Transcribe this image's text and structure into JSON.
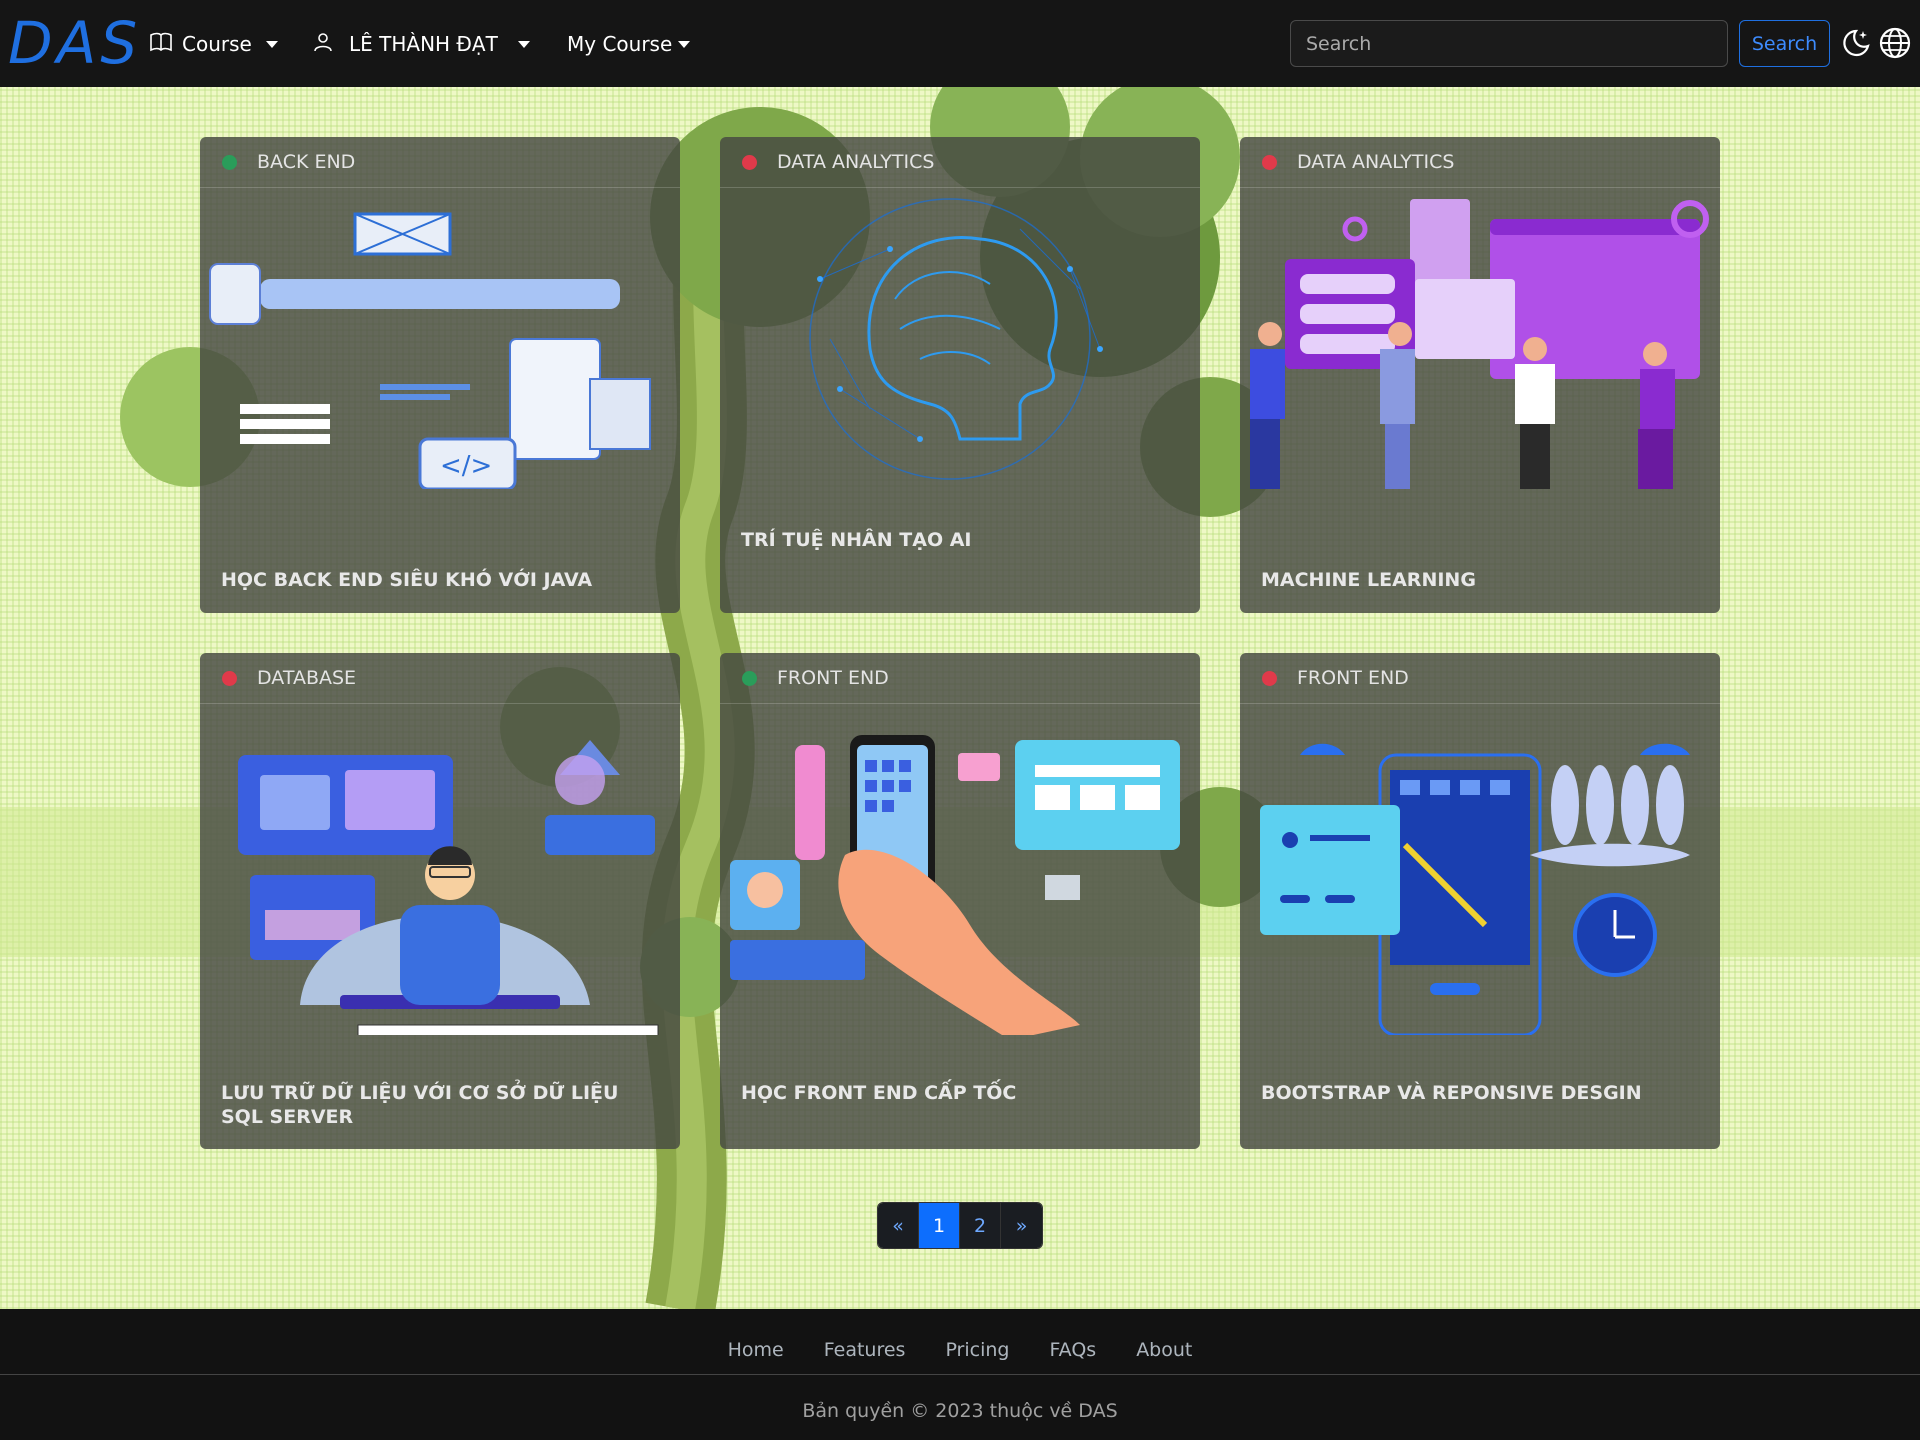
{
  "navbar": {
    "brand": "DAS",
    "course_label": "Course",
    "user_label": "LÊ THÀNH ĐẠT",
    "my_course_label": "My Course",
    "search_placeholder": "Search",
    "search_button": "Search"
  },
  "cards": [
    {
      "category": "BACK END",
      "status": "green",
      "title": "HỌC BACK END SIÊU KHÓ VỚI JAVA"
    },
    {
      "category": "DATA ANALYTICS",
      "status": "red",
      "title": "TRÍ TUỆ NHÂN TẠO AI"
    },
    {
      "category": "DATA ANALYTICS",
      "status": "red",
      "title": "MACHINE LEARNING"
    },
    {
      "category": "DATABASE",
      "status": "red",
      "title": "LƯU TRỮ DỮ LIỆU VỚI CƠ SỞ DỮ LIỆU SQL SERVER"
    },
    {
      "category": "FRONT END",
      "status": "green",
      "title": "HỌC FRONT END CẤP TỐC"
    },
    {
      "category": "FRONT END",
      "status": "red",
      "title": "BOOTSTRAP VÀ REPONSIVE DESGIN"
    }
  ],
  "pagination": {
    "prev": "«",
    "pages": [
      "1",
      "2"
    ],
    "active": "1",
    "next": "»"
  },
  "footer": {
    "links": [
      "Home",
      "Features",
      "Pricing",
      "FAQs",
      "About"
    ],
    "copyright": "Bản quyền © 2023 thuộc về DAS"
  },
  "colors": {
    "accent": "#0d6efd",
    "status_green": "#2a9d5a",
    "status_red": "#e03a4a"
  },
  "icons": [
    "book-icon",
    "person-icon",
    "moon-stars-icon",
    "globe-icon"
  ]
}
